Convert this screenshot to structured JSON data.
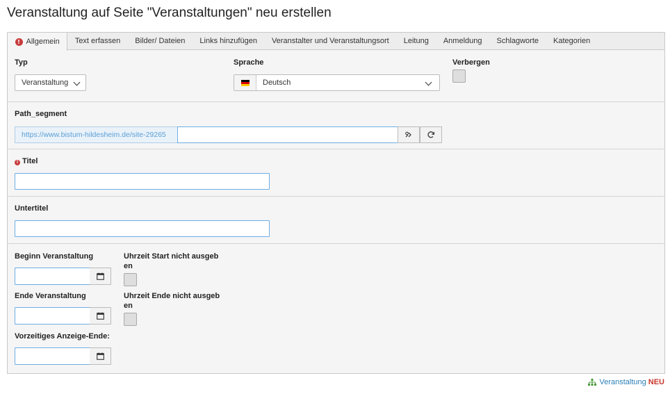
{
  "page_title": "Veranstaltung auf Seite \"Veranstaltungen\" neu erstellen",
  "tabs": [
    {
      "label": "Allgemein",
      "active": true,
      "has_error": true
    },
    {
      "label": "Text erfassen"
    },
    {
      "label": "Bilder/ Dateien"
    },
    {
      "label": "Links hinzufügen"
    },
    {
      "label": "Veranstalter und Veranstaltungsort"
    },
    {
      "label": "Leitung"
    },
    {
      "label": "Anmeldung"
    },
    {
      "label": "Schlagworte"
    },
    {
      "label": "Kategorien"
    }
  ],
  "fields": {
    "typ": {
      "label": "Typ",
      "value": "Veranstaltung"
    },
    "sprache": {
      "label": "Sprache",
      "value": "Deutsch",
      "flag": "flag-de-icon"
    },
    "verbergen": {
      "label": "Verbergen",
      "checked": false
    },
    "path_segment": {
      "label": "Path_segment",
      "prefix": "https://www.bistum-hildesheim.de/site-29265",
      "value": ""
    },
    "titel": {
      "label": "Titel",
      "required_error": true,
      "value": ""
    },
    "untertitel": {
      "label": "Untertitel",
      "value": ""
    },
    "beginn": {
      "label": "Beginn Veranstaltung",
      "value": ""
    },
    "uhrzeit_start": {
      "label_line1": "Uhrzeit Start nicht ausgeb",
      "label_line2": "en",
      "checked": false
    },
    "ende": {
      "label": "Ende Veranstaltung",
      "value": ""
    },
    "uhrzeit_ende": {
      "label_line1": "Uhrzeit Ende nicht ausgeb",
      "label_line2": "en",
      "checked": false
    },
    "anzeige_ende": {
      "label": "Vorzeitiges Anzeige-Ende:",
      "value": ""
    }
  },
  "footer": {
    "record_type": "Veranstaltung",
    "state": "NEU"
  },
  "colors": {
    "accent": "#6daee5",
    "error": "#c83c3c",
    "link": "#2b7fb8"
  }
}
